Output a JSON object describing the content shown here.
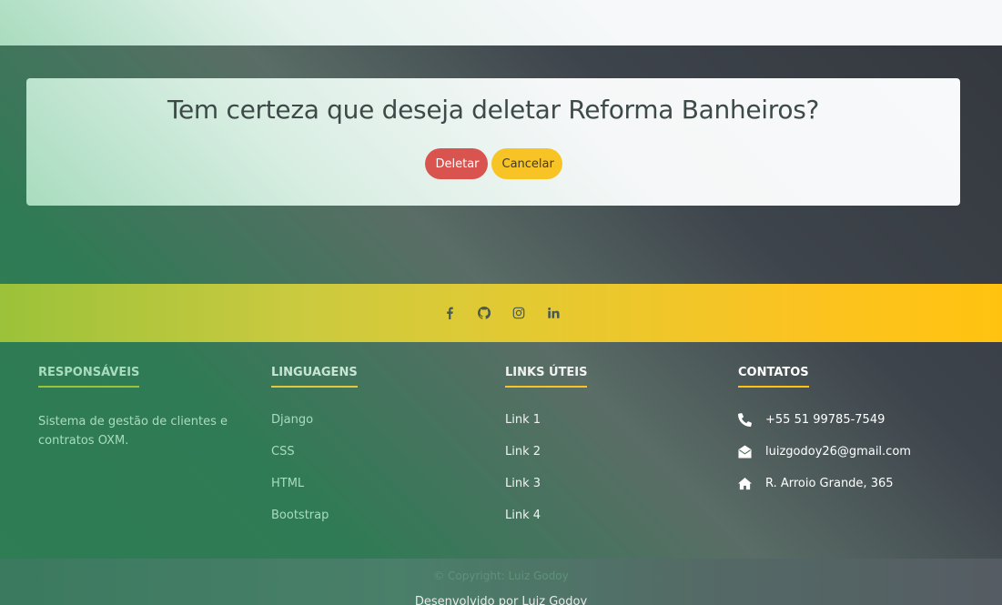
{
  "confirm": {
    "heading": "Tem certeza que deseja deletar Reforma Banheiros?",
    "delete_label": "Deletar",
    "cancel_label": "Cancelar"
  },
  "social": {
    "icons": [
      "facebook-icon",
      "github-icon",
      "instagram-icon",
      "linkedin-icon"
    ]
  },
  "footer": {
    "responsaveis": {
      "title": "Responsáveis",
      "text": "Sistema de gestão de clientes e contratos OXM."
    },
    "linguagens": {
      "title": "Linguagens",
      "items": [
        "Django",
        "CSS",
        "HTML",
        "Bootstrap"
      ]
    },
    "links": {
      "title": "Links Úteis",
      "items": [
        "Link 1",
        "Link 2",
        "Link 3",
        "Link 4"
      ]
    },
    "contatos": {
      "title": "Contatos",
      "phone": "+55 51 99785-7549",
      "email": "luizgodoy26@gmail.com",
      "address": "R. Arroio Grande, 365"
    }
  },
  "copyright": {
    "line1": "© Copyright: Luiz Godoy",
    "line2": "Desenvolvido por Luiz Godoy"
  },
  "colors": {
    "danger": "#d9534f",
    "warning": "#f7c325",
    "accent_green": "#9bc23a",
    "accent_yellow": "#ffc30f"
  }
}
